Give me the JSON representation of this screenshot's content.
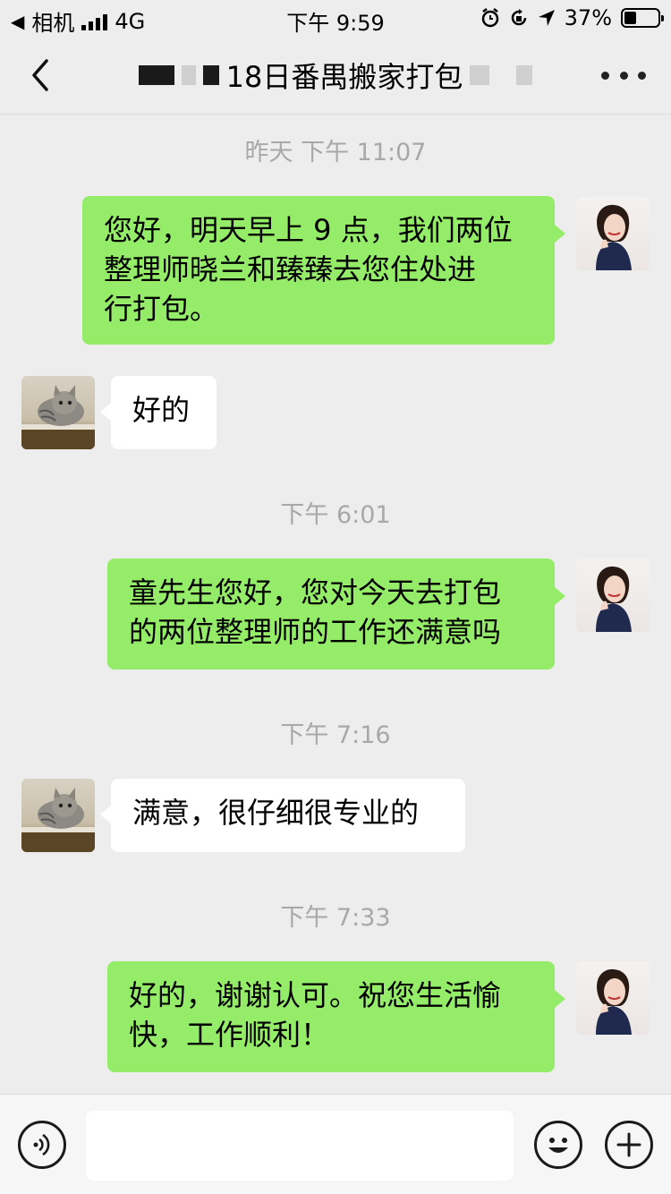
{
  "status_bar": {
    "back_app": "相机",
    "network": "4G",
    "time": "下午 9:59",
    "battery": "37%",
    "battery_level": 0.37
  },
  "nav": {
    "title": "18日番禺搬家打包",
    "back_icon": "chevron-left-icon",
    "more_icon": "more-dots-icon"
  },
  "messages": [
    {
      "type": "timestamp",
      "text": "昨天 下午 11:07"
    },
    {
      "type": "out",
      "lines": [
        "您好，明天早上 9 点，我们两位",
        "整理师晓兰和臻臻去您住处进",
        "行打包。"
      ]
    },
    {
      "type": "in",
      "lines": [
        "好的"
      ]
    },
    {
      "type": "timestamp",
      "text": "下午 6:01"
    },
    {
      "type": "out",
      "lines": [
        "童先生您好，您对今天去打包",
        "的两位整理师的工作还满意吗"
      ]
    },
    {
      "type": "timestamp",
      "text": "下午 7:16"
    },
    {
      "type": "in",
      "lines": [
        "满意，很仔细很专业的"
      ]
    },
    {
      "type": "timestamp",
      "text": "下午 7:33"
    },
    {
      "type": "out",
      "lines": [
        "好的，谢谢认可。祝您生活愉",
        "快，工作顺利！"
      ]
    }
  ],
  "input_bar": {
    "voice_icon": "voice-icon",
    "emoji_icon": "emoji-icon",
    "plus_icon": "plus-icon",
    "input_value": ""
  },
  "colors": {
    "background": "#ededed",
    "outgoing_bubble": "#95ec69",
    "incoming_bubble": "#ffffff",
    "timestamp_text": "#a8a8a8"
  }
}
